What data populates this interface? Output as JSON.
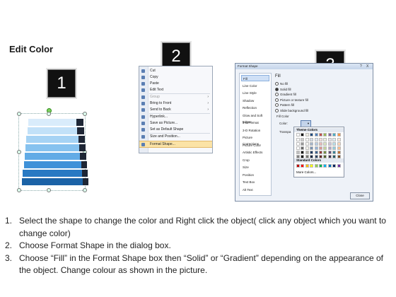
{
  "title": "Edit Color",
  "badges": [
    "1",
    "2",
    "3"
  ],
  "context_menu": {
    "items": [
      {
        "label": "Cut",
        "arrow": "",
        "disabled": false
      },
      {
        "label": "Copy",
        "arrow": "",
        "disabled": false
      },
      {
        "label": "Paste",
        "arrow": "",
        "disabled": false
      },
      {
        "label": "Edit Text",
        "arrow": "",
        "disabled": false
      },
      {
        "label": "Group",
        "arrow": "›",
        "disabled": true
      },
      {
        "label": "Bring to Front",
        "arrow": "›",
        "disabled": false
      },
      {
        "label": "Send to Back",
        "arrow": "›",
        "disabled": false
      },
      {
        "label": "Hyperlink...",
        "arrow": "",
        "disabled": false
      },
      {
        "label": "Save as Picture...",
        "arrow": "",
        "disabled": false
      },
      {
        "label": "Set as Default Shape",
        "arrow": "",
        "disabled": false
      },
      {
        "label": "Size and Position...",
        "arrow": "",
        "disabled": false
      },
      {
        "label": "Format Shape...",
        "arrow": "",
        "disabled": false
      }
    ]
  },
  "dialog": {
    "title": "Format Shape",
    "title_buttons": [
      "?",
      "X"
    ],
    "categories": [
      "Fill",
      "Line Color",
      "Line Style",
      "Shadow",
      "Reflection",
      "Glow and Soft Edges",
      "3-D Format",
      "3-D Rotation",
      "Picture Corrections",
      "Picture Color",
      "Artistic Effects",
      "Crop",
      "Size",
      "Position",
      "Text Box",
      "Alt Text"
    ],
    "selected_category": "Fill",
    "pane_header": "Fill",
    "fill_options": [
      {
        "label": "No fill",
        "checked": false
      },
      {
        "label": "Solid fill",
        "checked": true
      },
      {
        "label": "Gradient fill",
        "checked": false
      },
      {
        "label": "Picture or texture fill",
        "checked": false
      },
      {
        "label": "Pattern fill",
        "checked": false
      },
      {
        "label": "Slide background fill",
        "checked": false
      }
    ],
    "fill_color_header": "Fill Color",
    "color_label": "Color:",
    "transparency_label": "Transpa",
    "close_label": "Close"
  },
  "color_picker": {
    "theme_header": "Theme Colors",
    "standard_header": "Standard Colors",
    "more_colors": "More Colors...",
    "theme_top_row": [
      "#ffffff",
      "#000000",
      "#eeece1",
      "#1f497d",
      "#4f81bd",
      "#c0504d",
      "#9bbb59",
      "#8064a2",
      "#4bacc6",
      "#f79646"
    ],
    "standard_colors": [
      "#c00000",
      "#ff0000",
      "#ffc000",
      "#ffff00",
      "#92d050",
      "#00b050",
      "#00b0f0",
      "#0070c0",
      "#002060",
      "#7030a0"
    ]
  },
  "shape_bars": [
    "#d9ecfb",
    "#c2e1f8",
    "#a6d3f4",
    "#86c2ef",
    "#62abe6",
    "#3f91d8",
    "#2879c3",
    "#1b62a6"
  ],
  "instructions": [
    {
      "num": "1.",
      "text": "Select the shape to change the color and Right click the object( click any object which you want to change color)"
    },
    {
      "num": "2.",
      "text": "Choose Format Shape in the dialog box."
    },
    {
      "num": "3.",
      "text": "Choose “Fill” in the Format Shape box then “Solid” or “Gradient” depending on the appearance of the object. Change colour as shown in the picture."
    }
  ]
}
